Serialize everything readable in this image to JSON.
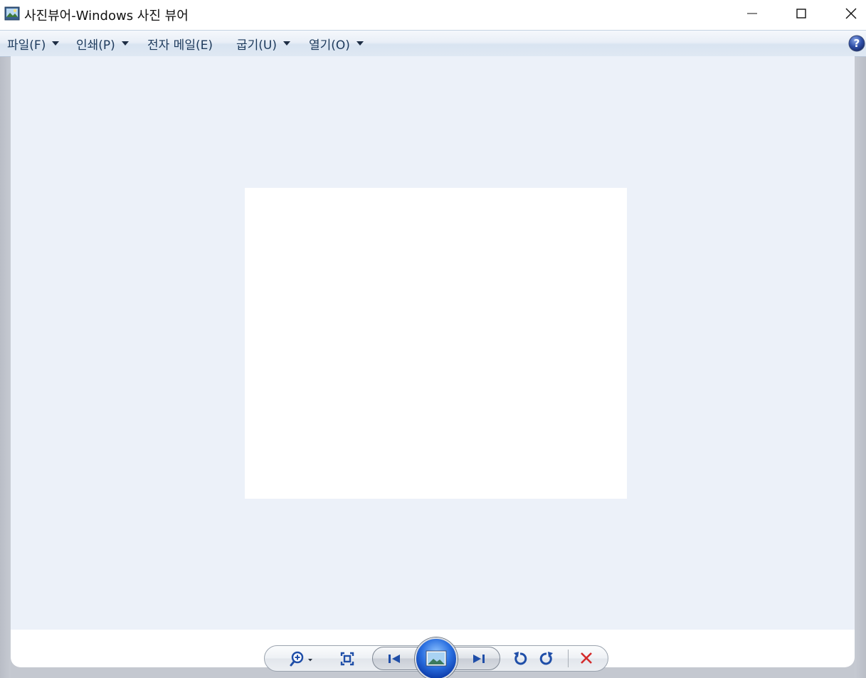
{
  "window": {
    "title": "사진뷰어-Windows 사진 뷰어",
    "minimize_icon": "minimize-icon",
    "maximize_icon": "maximize-icon",
    "close_icon": "close-icon"
  },
  "menubar": {
    "items": [
      {
        "label": "파일(F)",
        "has_dropdown": true
      },
      {
        "label": "인쇄(P)",
        "has_dropdown": true
      },
      {
        "label": "전자 메일(E)",
        "has_dropdown": false
      },
      {
        "label": "굽기(U)",
        "has_dropdown": true
      },
      {
        "label": "열기(O)",
        "has_dropdown": true
      }
    ],
    "help_icon": "help-icon"
  },
  "viewer": {
    "background": "#ecf1f9",
    "photo_color": "#ffffff"
  },
  "controls": {
    "zoom_icon": "zoom-icon",
    "actual_size_icon": "actual-size-icon",
    "previous_icon": "previous-icon",
    "slideshow_icon": "slideshow-icon",
    "next_icon": "next-icon",
    "rotate_ccw_icon": "rotate-counterclockwise-icon",
    "rotate_cw_icon": "rotate-clockwise-icon",
    "delete_icon": "delete-icon"
  },
  "colors": {
    "accent": "#1e5bd6",
    "delete": "#d42a2a",
    "menu_text": "#1d3a5c"
  }
}
